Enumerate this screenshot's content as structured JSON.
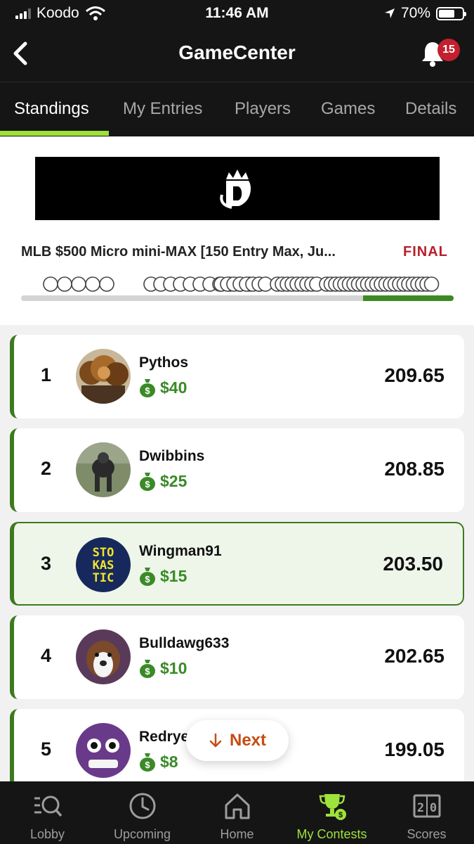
{
  "status_bar": {
    "carrier": "Koodo",
    "time": "11:46 AM",
    "battery": "70%",
    "battery_level": 0.7
  },
  "header": {
    "title": "GameCenter",
    "notification_count": "15"
  },
  "tabs": [
    {
      "label": "Standings",
      "active": true
    },
    {
      "label": "My Entries",
      "active": false
    },
    {
      "label": "Players",
      "active": false
    },
    {
      "label": "Games",
      "active": false
    },
    {
      "label": "Details",
      "active": false
    }
  ],
  "contest": {
    "name": "MLB $500 Micro mini-MAX [150 Entry Max, Ju...",
    "status": "FINAL",
    "progress": 0.79
  },
  "standings": [
    {
      "rank": "1",
      "username": "Pythos",
      "prize": "$40",
      "score": "209.65",
      "highlight": false
    },
    {
      "rank": "2",
      "username": "Dwibbins",
      "prize": "$25",
      "score": "208.85",
      "highlight": false
    },
    {
      "rank": "3",
      "username": "Wingman91",
      "prize": "$15",
      "score": "203.50",
      "highlight": true,
      "avatar_text": [
        "STO",
        "KAS",
        "TIC"
      ]
    },
    {
      "rank": "4",
      "username": "Bulldawg633",
      "prize": "$10",
      "score": "202.65",
      "highlight": false
    },
    {
      "rank": "5",
      "username": "Redrye",
      "prize": "$8",
      "score": "199.05",
      "highlight": false
    }
  ],
  "next_button": {
    "label": "Next"
  },
  "bottom_nav": [
    {
      "label": "Lobby",
      "icon": "lobby-search-icon",
      "active": false
    },
    {
      "label": "Upcoming",
      "icon": "clock-icon",
      "active": false
    },
    {
      "label": "Home",
      "icon": "home-icon",
      "active": false
    },
    {
      "label": "My Contests",
      "icon": "trophy-icon",
      "active": true
    },
    {
      "label": "Scores",
      "icon": "scoreboard-icon",
      "active": false
    }
  ],
  "colors": {
    "accent_green": "#9ee23c",
    "money_green": "#3a8a27",
    "final_red": "#b81e2d",
    "next_orange": "#c64c14"
  }
}
